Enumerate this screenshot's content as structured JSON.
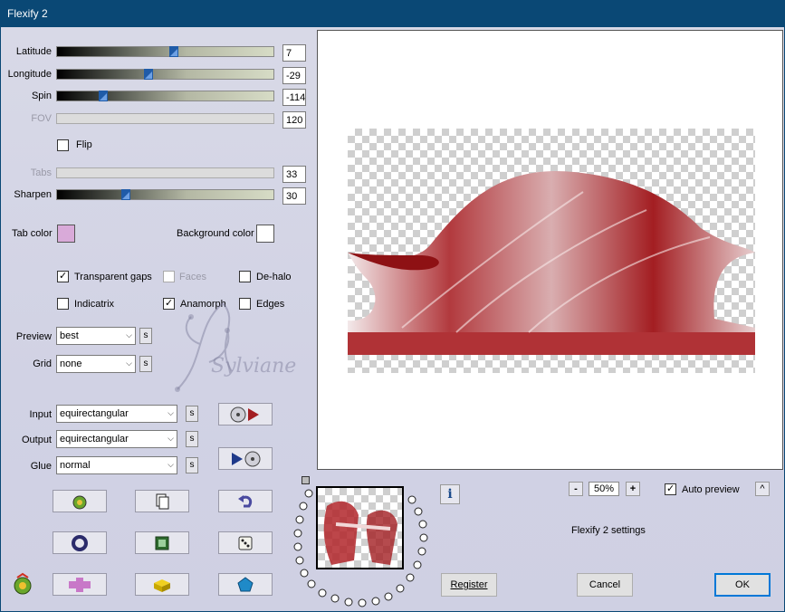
{
  "window": {
    "title": "Flexify 2"
  },
  "sliders": [
    {
      "name": "latitude",
      "label": "Latitude",
      "value": "7",
      "fraction": 0.54,
      "enabled": true
    },
    {
      "name": "longitude",
      "label": "Longitude",
      "value": "-29",
      "fraction": 0.42,
      "enabled": true
    },
    {
      "name": "spin",
      "label": "Spin",
      "value": "-114",
      "fraction": 0.2,
      "enabled": true
    },
    {
      "name": "fov",
      "label": "FOV",
      "value": "120",
      "fraction": null,
      "enabled": false
    },
    {
      "name": "tabs",
      "label": "Tabs",
      "value": "33",
      "fraction": null,
      "enabled": false
    },
    {
      "name": "sharpen",
      "label": "Sharpen",
      "value": "30",
      "fraction": 0.31,
      "enabled": true
    }
  ],
  "flip": {
    "label": "Flip",
    "checked": false
  },
  "tab_color": {
    "label": "Tab color",
    "color": "#d9aad9"
  },
  "background_color": {
    "label": "Background color",
    "color": "#ffffff"
  },
  "options": {
    "transparent_gaps": {
      "label": "Transparent gaps",
      "checked": true
    },
    "faces": {
      "label": "Faces",
      "checked": false,
      "enabled": false
    },
    "de_halo": {
      "label": "De-halo",
      "checked": false
    },
    "indicatrix": {
      "label": "Indicatrix",
      "checked": false
    },
    "anamorph": {
      "label": "Anamorph",
      "checked": true
    },
    "edges": {
      "label": "Edges",
      "checked": false
    }
  },
  "selects": {
    "preview": {
      "label": "Preview",
      "value": "best"
    },
    "grid": {
      "label": "Grid",
      "value": "none"
    },
    "input": {
      "label": "Input",
      "value": "equirectangular"
    },
    "output": {
      "label": "Output",
      "value": "equirectangular"
    },
    "glue": {
      "label": "Glue",
      "value": "normal"
    }
  },
  "s_button": "s",
  "check_mark": "✓",
  "combo_arrow": "⌵",
  "watermark": "Sylviane",
  "zoom": {
    "level": "50%",
    "minus": "-",
    "plus": "+"
  },
  "auto_preview": {
    "label": "Auto preview",
    "checked": true
  },
  "collapse_button": "^",
  "info_button": "i",
  "settings_name": "Flexify 2 settings",
  "buttons": {
    "register": "Register",
    "cancel": "Cancel",
    "ok": "OK"
  },
  "colors": {
    "title_bar": "#0a4875",
    "accent": "#0078d7",
    "image_red": "#a31e22"
  }
}
